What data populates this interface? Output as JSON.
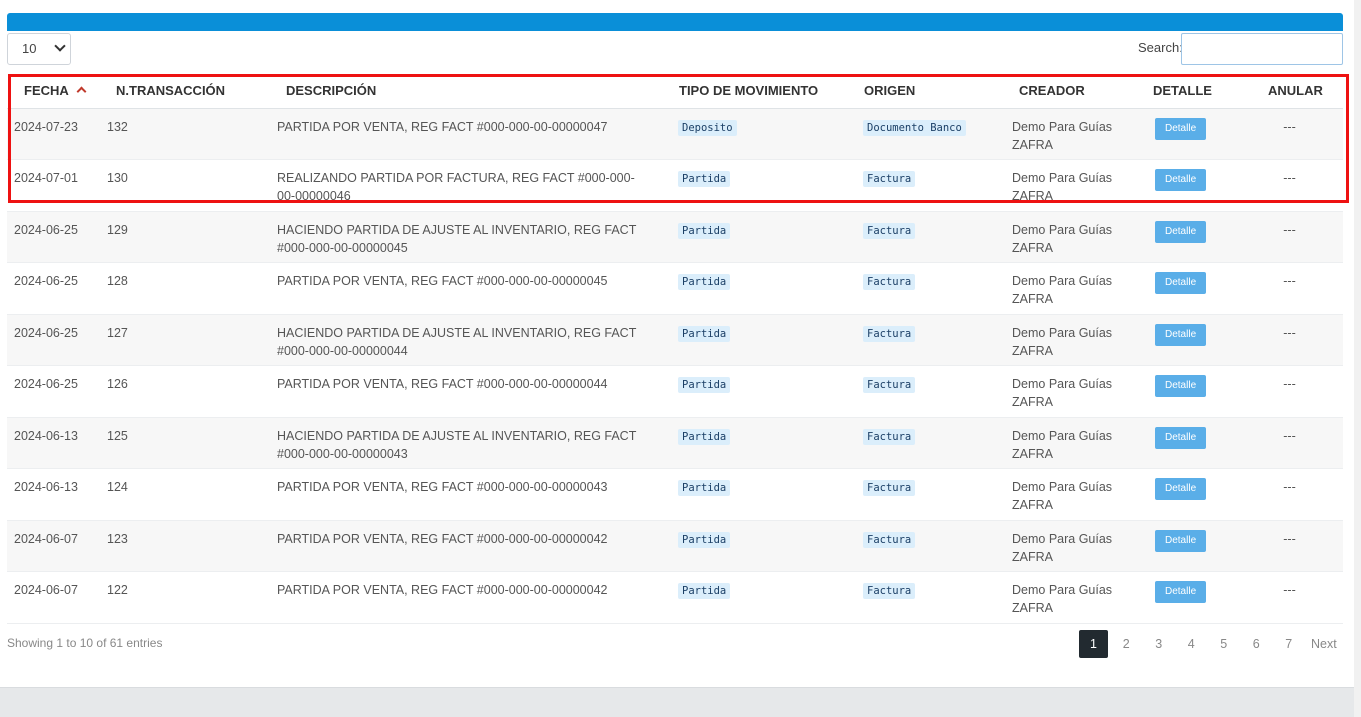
{
  "length": {
    "value": "10"
  },
  "search": {
    "label": "Search:",
    "value": ""
  },
  "columns": [
    "FECHA",
    "N.TRANSACCIÓN",
    "DESCRIPCIÓN",
    "TIPO DE MOVIMIENTO",
    "ORIGEN",
    "CREADOR",
    "DETALLE",
    "ANULAR"
  ],
  "rows": [
    {
      "fecha": "2024-07-23",
      "tran": "132",
      "desc": "PARTIDA POR VENTA, REG FACT #000-000-00-00000047",
      "tipo": "Deposito",
      "origen": "Documento Banco",
      "creador": "Demo Para Guías ZAFRA",
      "detalle": "Detalle",
      "anular": "---"
    },
    {
      "fecha": "2024-07-01",
      "tran": "130",
      "desc": "REALIZANDO PARTIDA POR FACTURA, REG FACT #000-000-00-00000046",
      "tipo": "Partida",
      "origen": "Factura",
      "creador": "Demo Para Guías ZAFRA",
      "detalle": "Detalle",
      "anular": "---"
    },
    {
      "fecha": "2024-06-25",
      "tran": "129",
      "desc": "HACIENDO PARTIDA DE AJUSTE AL INVENTARIO, REG FACT #000-000-00-00000045",
      "tipo": "Partida",
      "origen": "Factura",
      "creador": "Demo Para Guías ZAFRA",
      "detalle": "Detalle",
      "anular": "---"
    },
    {
      "fecha": "2024-06-25",
      "tran": "128",
      "desc": "PARTIDA POR VENTA, REG FACT #000-000-00-00000045",
      "tipo": "Partida",
      "origen": "Factura",
      "creador": "Demo Para Guías ZAFRA",
      "detalle": "Detalle",
      "anular": "---"
    },
    {
      "fecha": "2024-06-25",
      "tran": "127",
      "desc": "HACIENDO PARTIDA DE AJUSTE AL INVENTARIO, REG FACT #000-000-00-00000044",
      "tipo": "Partida",
      "origen": "Factura",
      "creador": "Demo Para Guías ZAFRA",
      "detalle": "Detalle",
      "anular": "---"
    },
    {
      "fecha": "2024-06-25",
      "tran": "126",
      "desc": "PARTIDA POR VENTA, REG FACT #000-000-00-00000044",
      "tipo": "Partida",
      "origen": "Factura",
      "creador": "Demo Para Guías ZAFRA",
      "detalle": "Detalle",
      "anular": "---"
    },
    {
      "fecha": "2024-06-13",
      "tran": "125",
      "desc": "HACIENDO PARTIDA DE AJUSTE AL INVENTARIO, REG FACT #000-000-00-00000043",
      "tipo": "Partida",
      "origen": "Factura",
      "creador": "Demo Para Guías ZAFRA",
      "detalle": "Detalle",
      "anular": "---"
    },
    {
      "fecha": "2024-06-13",
      "tran": "124",
      "desc": "PARTIDA POR VENTA, REG FACT #000-000-00-00000043",
      "tipo": "Partida",
      "origen": "Factura",
      "creador": "Demo Para Guías ZAFRA",
      "detalle": "Detalle",
      "anular": "---"
    },
    {
      "fecha": "2024-06-07",
      "tran": "123",
      "desc": "PARTIDA POR VENTA, REG FACT #000-000-00-00000042",
      "tipo": "Partida",
      "origen": "Factura",
      "creador": "Demo Para Guías ZAFRA",
      "detalle": "Detalle",
      "anular": "---"
    },
    {
      "fecha": "2024-06-07",
      "tran": "122",
      "desc": "PARTIDA POR VENTA, REG FACT #000-000-00-00000042",
      "tipo": "Partida",
      "origen": "Factura",
      "creador": "Demo Para Guías ZAFRA",
      "detalle": "Detalle",
      "anular": "---"
    }
  ],
  "info": "Showing 1 to 10 of 61 entries",
  "pagination": {
    "pages": [
      "1",
      "2",
      "3",
      "4",
      "5",
      "6",
      "7"
    ],
    "active": "1",
    "next": "Next"
  },
  "colors": {
    "header_bar": "#0a8fd8",
    "highlight": "#ee1111",
    "detail_button": "#5aaee8",
    "badge_bg": "#dbeefb",
    "active_page": "#222a30"
  }
}
